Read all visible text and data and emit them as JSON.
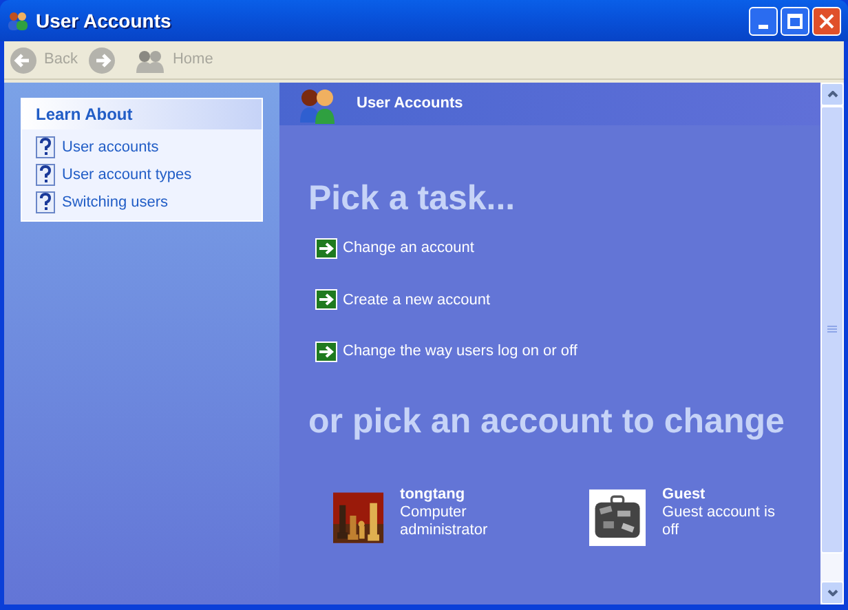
{
  "window": {
    "title": "User Accounts"
  },
  "toolbar": [
    {
      "kind": "back",
      "label": "Back",
      "disabled": true
    },
    {
      "kind": "forward",
      "disabled": true
    },
    {
      "kind": "home",
      "label": "Home",
      "disabled": true
    }
  ],
  "sidebar": {
    "title": "Learn About",
    "items": [
      {
        "label": "User accounts"
      },
      {
        "label": "User account types"
      },
      {
        "label": "Switching users"
      }
    ]
  },
  "header": {
    "title": "User Accounts"
  },
  "tasks": {
    "heading": "Pick a task...",
    "items": [
      {
        "label": "Change an account"
      },
      {
        "label": "Create a new account"
      },
      {
        "label": "Change the way users log on or off"
      }
    ]
  },
  "accounts": {
    "heading": "or pick an account to change",
    "items": [
      {
        "kind": "chess",
        "name": "tongtang",
        "description": "Computer administrator"
      },
      {
        "kind": "suitcase",
        "name": "Guest",
        "description": "Guest account is off"
      }
    ]
  }
}
